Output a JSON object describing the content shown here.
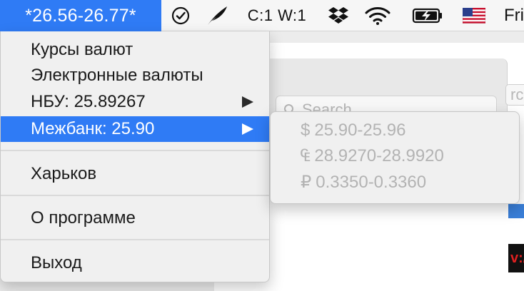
{
  "menubar": {
    "rate_label": "*26.56-26.77*",
    "status_cw": "C:1 W:1",
    "clock_partial": "Fri",
    "icons": [
      "checkmark-circle-icon",
      "feather-icon",
      "dropbox-icon",
      "wifi-icon",
      "battery-charging-icon",
      "us-flag-icon"
    ]
  },
  "menu": {
    "items": [
      {
        "label": "Курсы валют"
      },
      {
        "label": "Электронные валюты"
      },
      {
        "label": "НБУ: 25.89267",
        "has_submenu": true
      },
      {
        "label": "Межбанк: 25.90",
        "has_submenu": true,
        "selected": true
      },
      {
        "label": "Харьков"
      },
      {
        "label": "О программе"
      },
      {
        "label": "Выход"
      }
    ]
  },
  "submenu": {
    "items": [
      {
        "symbol": "$",
        "label": "25.90-25.96"
      },
      {
        "symbol": "₠",
        "label": "28.9270-28.9920"
      },
      {
        "symbol": "₽",
        "label": "0.3350-0.3360"
      }
    ]
  },
  "background_window": {
    "search_placeholder": "Search",
    "search_right_partial": "rch",
    "red_text_partial": "v:/"
  },
  "colors": {
    "selection_blue": "#2f7bf5",
    "menu_bg": "#f0f0f0",
    "disabled_text": "#b3b3b3"
  }
}
